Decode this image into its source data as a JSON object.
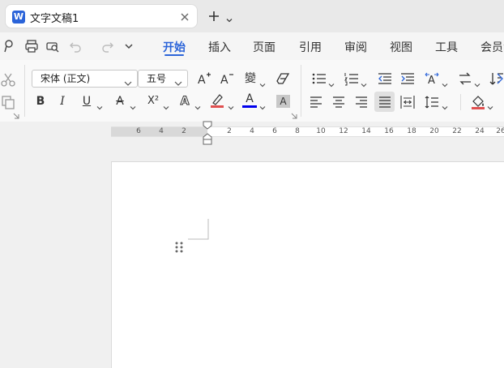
{
  "tab": {
    "logo": "W",
    "title": "文字文稿1"
  },
  "menu": {
    "tabs": [
      {
        "label": "开始"
      },
      {
        "label": "插入"
      },
      {
        "label": "页面"
      },
      {
        "label": "引用"
      },
      {
        "label": "审阅"
      },
      {
        "label": "视图"
      },
      {
        "label": "工具"
      },
      {
        "label": "会员专"
      }
    ],
    "active_index": 0
  },
  "ribbon": {
    "font_name": "宋体 (正文)",
    "font_size": "五号",
    "bold": "B",
    "italic": "I",
    "underline": "U",
    "strike": "A",
    "superscript": "X²",
    "text_effect": "A",
    "highlight_label": "A",
    "font_color_label": "A",
    "char_shade": "A",
    "phonetic": "變",
    "font_grow": "A⁺",
    "font_shrink": "A⁻",
    "font_color_hex": "#0000ee",
    "highlight_hex": "#e05050"
  },
  "ruler": {
    "labels": [
      "6",
      "4",
      "2",
      "2",
      "4",
      "6",
      "8",
      "10",
      "12",
      "14",
      "16",
      "18",
      "20",
      "22",
      "24",
      "26"
    ]
  },
  "accent": "#2b64d9"
}
